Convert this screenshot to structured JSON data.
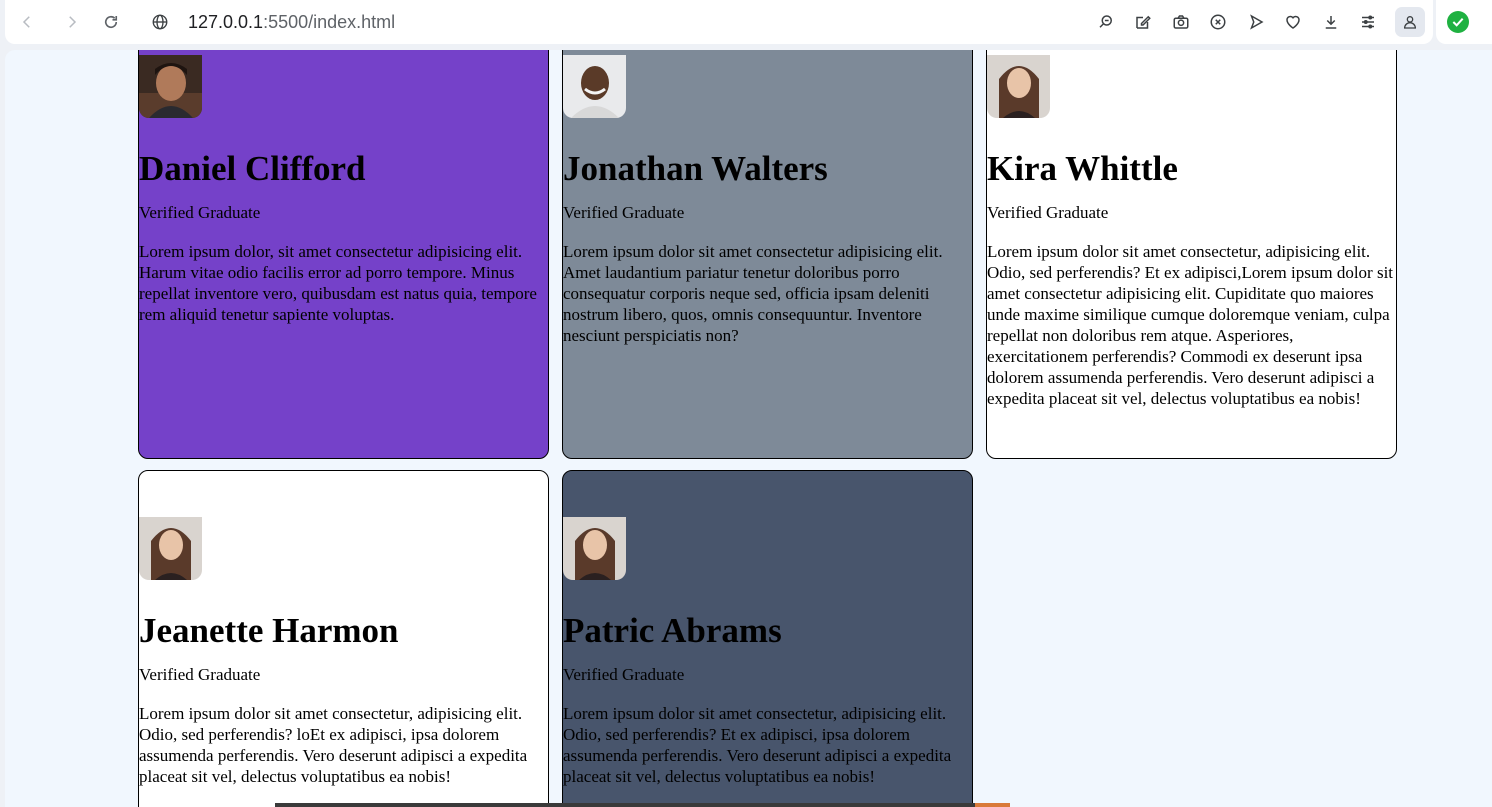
{
  "browser": {
    "back_icon": "back-arrow-icon",
    "forward_icon": "forward-arrow-icon",
    "reload_icon": "reload-icon",
    "site_info_icon": "globe-icon",
    "url_host": "127.0.0.1",
    "url_rest": ":5500/index.html",
    "toolbar_icons": [
      "zoom-icon",
      "edit-icon",
      "camera-icon",
      "block-icon",
      "send-icon",
      "heart-icon",
      "download-icon",
      "menu-icon"
    ],
    "profile_icon": "profile-icon",
    "extension_icon": "check-circle-icon",
    "extension_color": "#1fb141"
  },
  "cards": [
    {
      "name": " Daniel Clifford",
      "role": "Verified Graduate",
      "text": "Lorem ipsum dolor, sit amet consectetur adipisicing elit. Harum vitae odio facilis error ad porro tempore. Minus repellat inventore vero, quibusdam est natus quia, tempore rem aliquid tenetur sapiente voluptas.",
      "background": "#7541c9"
    },
    {
      "name": "Jonathan Walters",
      "role": "Verified Graduate",
      "text": "Lorem ipsum dolor sit amet consectetur adipisicing elit. Amet laudantium pariatur tenetur doloribus porro consequatur corporis neque sed, officia ipsam deleniti nostrum libero, quos, omnis consequuntur. Inventore nesciunt perspiciatis non?",
      "background": "#7e8a98"
    },
    {
      "name": "Kira Whittle",
      "role": "Verified Graduate",
      "text": "Lorem ipsum dolor sit amet consectetur, adipisicing elit. Odio, sed perferendis? Et ex adipisci,Lorem ipsum dolor sit amet consectetur adipisicing elit. Cupiditate quo maiores unde maxime similique cumque doloremque veniam, culpa repellat non doloribus rem atque. Asperiores, exercitationem perferendis? Commodi ex deserunt ipsa dolorem assumenda perferendis. Vero deserunt adipisci a expedita placeat sit vel, delectus voluptatibus ea nobis!",
      "background": "#ffffff"
    },
    {
      "name": "Jeanette Harmon",
      "role": "Verified Graduate",
      "text": "Lorem ipsum dolor sit amet consectetur, adipisicing elit. Odio, sed perferendis? loEt ex adipisci, ipsa dolorem assumenda perferendis. Vero deserunt adipisci a expedita placeat sit vel, delectus voluptatibus ea nobis!",
      "background": "#ffffff"
    },
    {
      "name": "Patric Abrams",
      "role": "Verified Graduate",
      "text": "Lorem ipsum dolor sit amet consectetur, adipisicing elit. Odio, sed perferendis? Et ex adipisci, ipsa dolorem assumenda perferendis. Vero deserunt adipisci a expedita placeat sit vel, delectus voluptatibus ea nobis!",
      "background": "#48556c"
    }
  ]
}
